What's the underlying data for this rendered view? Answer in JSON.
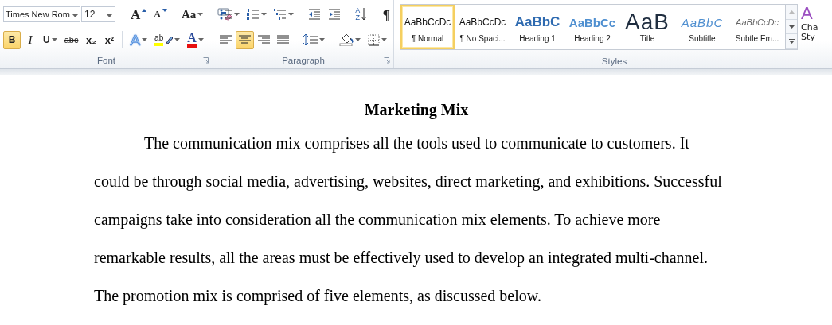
{
  "ribbon": {
    "groups": [
      {
        "kind": "font",
        "label": "Font",
        "rows": [
          [
            [
              {
                "kind": "font-name",
                "value": "Times New Rom"
              },
              {
                "kind": "font-size",
                "value": "12"
              }
            ],
            [
              {
                "kind": "grow-font",
                "glyph": "A",
                "pressed": false
              },
              {
                "kind": "shrink-font",
                "glyph": "A",
                "pressed": false
              }
            ],
            [
              {
                "kind": "change-case",
                "glyph": "Aa",
                "pressed": false
              }
            ],
            [
              {
                "kind": "clear-format",
                "pressed": false
              }
            ]
          ],
          [
            [
              {
                "kind": "bold",
                "glyph": "B",
                "pressed": true
              },
              {
                "kind": "italic",
                "glyph": "I",
                "pressed": false
              },
              {
                "kind": "underline",
                "glyph": "U",
                "pressed": false
              },
              {
                "kind": "strikethrough",
                "glyph": "abc",
                "pressed": false
              },
              {
                "kind": "subscript",
                "glyph": "x₂",
                "pressed": false
              },
              {
                "kind": "superscript",
                "glyph": "x²",
                "pressed": false
              }
            ],
            [
              {
                "kind": "text-effects",
                "glyph": "A",
                "pressed": false
              },
              {
                "kind": "highlight",
                "glyph": "ab",
                "pressed": false
              },
              {
                "kind": "font-color",
                "glyph": "A",
                "pressed": false
              }
            ]
          ]
        ]
      },
      {
        "kind": "paragraph",
        "label": "Paragraph",
        "rows": [
          [
            [
              {
                "kind": "bullets",
                "pressed": false
              },
              {
                "kind": "numbering",
                "pressed": false
              },
              {
                "kind": "multilevel",
                "pressed": false
              }
            ],
            [
              {
                "kind": "decrease-indent",
                "pressed": false
              },
              {
                "kind": "increase-indent",
                "pressed": false
              }
            ],
            [
              {
                "kind": "sort",
                "glyph": "AZ",
                "pressed": false
              }
            ],
            [
              {
                "kind": "show-marks",
                "glyph": "¶",
                "pressed": false
              }
            ]
          ],
          [
            [
              {
                "kind": "align-left",
                "pressed": false
              },
              {
                "kind": "align-center",
                "pressed": true
              },
              {
                "kind": "align-right",
                "pressed": false
              },
              {
                "kind": "justify",
                "pressed": false
              }
            ],
            [
              {
                "kind": "line-spacing",
                "pressed": false
              }
            ],
            [
              {
                "kind": "shading",
                "pressed": false
              },
              {
                "kind": "borders",
                "pressed": false
              }
            ]
          ]
        ]
      },
      {
        "kind": "styles",
        "label": "Styles",
        "items": [
          {
            "kind": "normal",
            "sample": "AaBbCcDc",
            "label": "¶ Normal",
            "selected": true
          },
          {
            "kind": "no-spacing",
            "sample": "AaBbCcDc",
            "label": "¶ No Spaci...",
            "selected": false
          },
          {
            "kind": "heading1",
            "sample": "AaBbC",
            "label": "Heading 1",
            "selected": false
          },
          {
            "kind": "heading2",
            "sample": "AaBbCc",
            "label": "Heading 2",
            "selected": false
          },
          {
            "kind": "title",
            "sample": "AaB",
            "label": "Title",
            "selected": false
          },
          {
            "kind": "subtitle",
            "sample": "AaBbC",
            "label": "Subtitle",
            "selected": false
          },
          {
            "kind": "subtle-emphasis",
            "sample": "AaBbCcDc",
            "label": "Subtle Em...",
            "selected": false
          }
        ],
        "change_styles": {
          "glyph": "A",
          "label_lines": [
            "Cha",
            "Sty"
          ]
        }
      }
    ]
  },
  "document": {
    "title": "Marketing Mix",
    "paragraphs": [
      "The communication mix comprises all the tools used to communicate to customers. It could be through social media, advertising, websites, direct marketing, and exhibitions. Successful campaigns take into consideration all the communication mix elements. To achieve more remarkable results, all the areas must be effectively used to develop an integrated multi-channel. The promotion mix is comprised of five elements, as discussed below."
    ]
  }
}
